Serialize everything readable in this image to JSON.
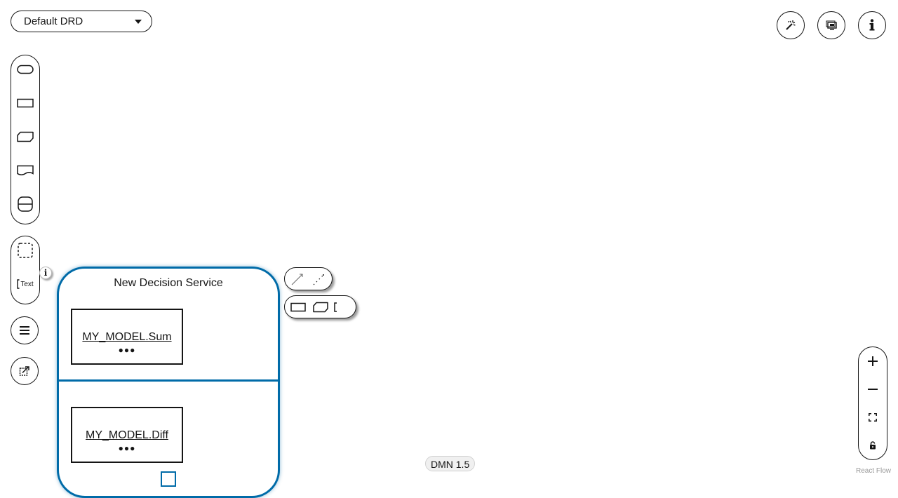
{
  "drd_selector": {
    "value": "Default DRD"
  },
  "top_right_actions": [
    {
      "icon": "magic-wand-icon"
    },
    {
      "icon": "screen-overlays-icon"
    },
    {
      "icon": "info-icon"
    }
  ],
  "node_palette": [
    {
      "icon": "input-data-icon"
    },
    {
      "icon": "decision-icon"
    },
    {
      "icon": "business-knowledge-model-icon"
    },
    {
      "icon": "knowledge-source-icon"
    },
    {
      "icon": "decision-service-icon"
    }
  ],
  "annotation_palette": {
    "group_icon": "group-icon",
    "text_annotation_label": "Text"
  },
  "decision_service": {
    "title": "New Decision Service",
    "output_decision": {
      "name": "MY_MODEL.Sum",
      "dots": "●●●"
    },
    "encapsulated_decision": {
      "name": "MY_MODEL.Diff",
      "dots": "●●●"
    }
  },
  "info_badge": {
    "glyph": "i"
  },
  "dmn_version": "DMN 1.5",
  "attribution": "React Flow",
  "colors": {
    "selection": "#006ba8",
    "stroke": "#151515"
  }
}
